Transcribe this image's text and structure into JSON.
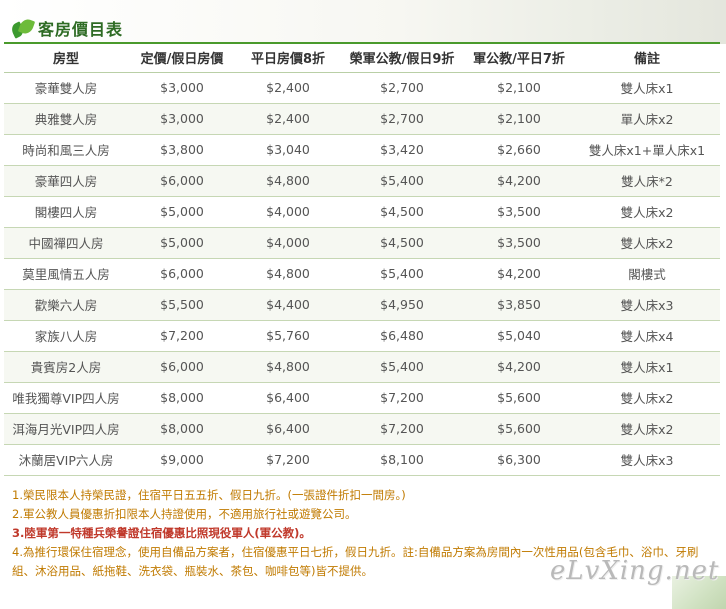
{
  "page": {
    "title": "客房價目表"
  },
  "table": {
    "headers": [
      "房型",
      "定價/假日房價",
      "平日房價8折",
      "榮軍公教/假日9折",
      "軍公教/平日7折",
      "備註"
    ],
    "rows": [
      [
        "豪華雙人房",
        "$3,000",
        "$2,400",
        "$2,700",
        "$2,100",
        "雙人床x1"
      ],
      [
        "典雅雙人房",
        "$3,000",
        "$2,400",
        "$2,700",
        "$2,100",
        "單人床x2"
      ],
      [
        "時尚和風三人房",
        "$3,800",
        "$3,040",
        "$3,420",
        "$2,660",
        "雙人床x1+單人床x1"
      ],
      [
        "豪華四人房",
        "$6,000",
        "$4,800",
        "$5,400",
        "$4,200",
        "雙人床*2"
      ],
      [
        "閣樓四人房",
        "$5,000",
        "$4,000",
        "$4,500",
        "$3,500",
        "雙人床x2"
      ],
      [
        "中國禪四人房",
        "$5,000",
        "$4,000",
        "$4,500",
        "$3,500",
        "雙人床x2"
      ],
      [
        "莫里風情五人房",
        "$6,000",
        "$4,800",
        "$5,400",
        "$4,200",
        "閣樓式"
      ],
      [
        "歡樂六人房",
        "$5,500",
        "$4,400",
        "$4,950",
        "$3,850",
        "雙人床x3"
      ],
      [
        "家族八人房",
        "$7,200",
        "$5,760",
        "$6,480",
        "$5,040",
        "雙人床x4"
      ],
      [
        "貴賓房2人房",
        "$6,000",
        "$4,800",
        "$5,400",
        "$4,200",
        "雙人床x1"
      ],
      [
        "唯我獨尊VIP四人房",
        "$8,000",
        "$6,400",
        "$7,200",
        "$5,600",
        "雙人床x2"
      ],
      [
        "洱海月光VIP四人房",
        "$8,000",
        "$6,400",
        "$7,200",
        "$5,600",
        "雙人床x2"
      ],
      [
        "沐蘭居VIP六人房",
        "$9,000",
        "$7,200",
        "$8,100",
        "$6,300",
        "雙人床x3"
      ]
    ]
  },
  "notes": [
    "1.榮民限本人持榮民證，住宿平日五五折、假日九折。(一張證件折扣一間房。)",
    "2.軍公教人員優惠折扣限本人持證使用，不適用旅行社或遊覽公司。",
    "3.陸軍第一特種兵榮譽證住宿優惠比照現役軍人(軍公教)。",
    "4.為推行環保住宿理念，使用自備品方案者，住宿優惠平日七折，假日九折。註:自備品方案為房間內一次性用品(包含毛巾、浴巾、牙刷組、沐浴用品、紙拖鞋、洗衣袋、瓶裝水、茶包、咖啡包等)皆不提供。"
  ],
  "watermark": "eLvXing.net",
  "colors": {
    "accent": "#2e6b24",
    "rule": "#4a9a2c",
    "note": "#c07a00",
    "note_emphasis": "#c0392b"
  },
  "icons": {
    "title": "leaf-icon"
  }
}
